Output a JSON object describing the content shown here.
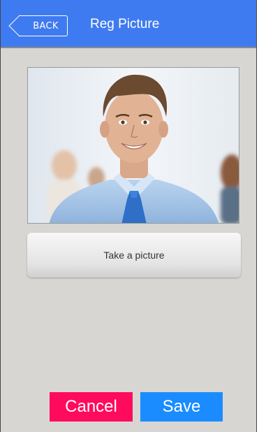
{
  "header": {
    "back_label": "BACK",
    "title": "Reg Picture",
    "background_color": "#3f7bf0"
  },
  "photo": {
    "description_icon": "person-photo"
  },
  "actions": {
    "take_picture_label": "Take a picture",
    "cancel_label": "Cancel",
    "save_label": "Save",
    "cancel_color": "#ff0b5e",
    "save_color": "#1a8cff"
  }
}
